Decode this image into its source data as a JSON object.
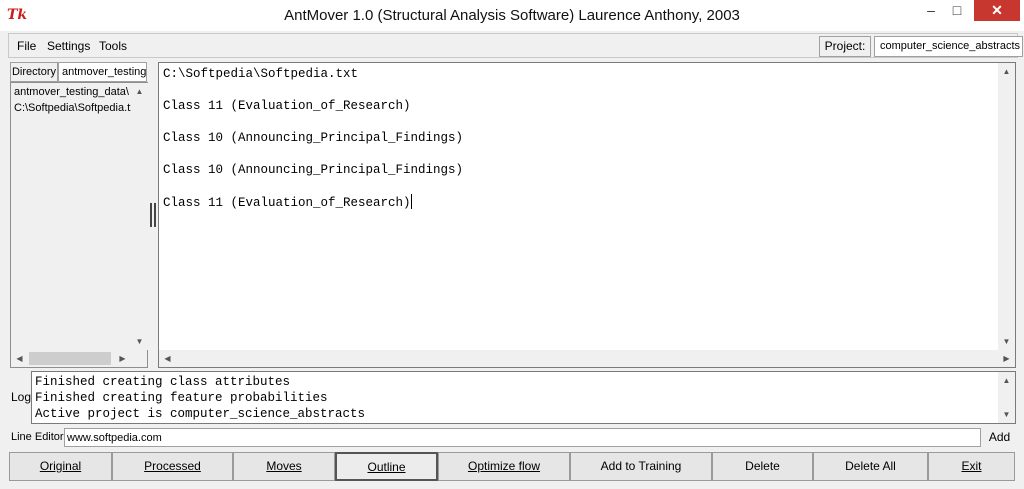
{
  "window": {
    "title": "AntMover 1.0 (Structural Analysis Software) Laurence Anthony, 2003",
    "icon_text": "Tk",
    "minimize": "–",
    "maximize": "□",
    "close": "✕"
  },
  "menu": {
    "items": [
      "File",
      "Settings",
      "Tools"
    ],
    "project_label": "Project:",
    "project_value": "computer_science_abstracts"
  },
  "directory": {
    "label": "Directory",
    "value": "antmover_testing_",
    "entries": [
      "antmover_testing_data\\",
      "C:\\Softpedia\\Softpedia.txt"
    ]
  },
  "editor": {
    "lines": [
      "C:\\Softpedia\\Softpedia.txt",
      "",
      "Class 11 (Evaluation_of_Research)",
      "",
      "Class 10 (Announcing_Principal_Findings)",
      "",
      "Class 10 (Announcing_Principal_Findings)",
      "",
      "Class 11 (Evaluation_of_Research)"
    ]
  },
  "log": {
    "label": "Log",
    "lines": [
      "Finished creating class attributes",
      "Finished creating feature probabilities",
      "Active project is computer_science_abstracts"
    ]
  },
  "line_editor": {
    "label": "Line Editor",
    "value": "www.softpedia.com",
    "add_label": "Add"
  },
  "buttons": {
    "original": "Original",
    "processed": "Processed",
    "moves": "Moves",
    "outline": "Outline",
    "optimize_flow": "Optimize flow",
    "add_to_training": "Add to Training",
    "delete": "Delete",
    "delete_all": "Delete All",
    "exit": "Exit"
  },
  "colors": {
    "close_button": "#c7372f",
    "icon": "#c81e1e"
  }
}
